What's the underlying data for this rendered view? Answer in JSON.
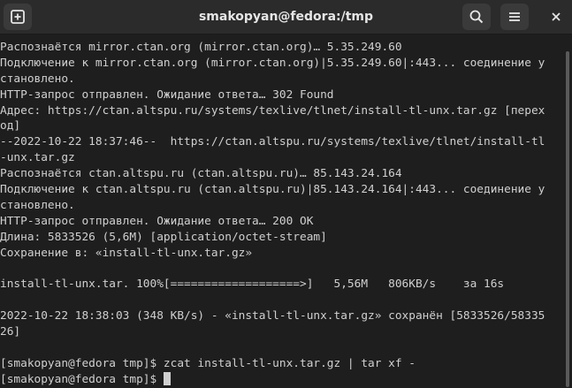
{
  "window": {
    "title": "smakopyan@fedora:/tmp"
  },
  "icons": {
    "new_tab": "new-tab-icon",
    "search": "search-icon",
    "menu": "hamburger-menu-icon",
    "close": "close-icon"
  },
  "terminal": {
    "lines": [
      "Распознаётся mirror.ctan.org (mirror.ctan.org)… 5.35.249.60",
      "Подключение к mirror.ctan.org (mirror.ctan.org)|5.35.249.60|:443... соединение у",
      "становлено.",
      "HTTP-запрос отправлен. Ожидание ответа… 302 Found",
      "Адрес: https://ctan.altspu.ru/systems/texlive/tlnet/install-tl-unx.tar.gz [перех",
      "од]",
      "--2022-10-22 18:37:46--  https://ctan.altspu.ru/systems/texlive/tlnet/install-tl",
      "-unx.tar.gz",
      "Распознаётся ctan.altspu.ru (ctan.altspu.ru)… 85.143.24.164",
      "Подключение к ctan.altspu.ru (ctan.altspu.ru)|85.143.24.164|:443... соединение у",
      "становлено.",
      "HTTP-запрос отправлен. Ожидание ответа… 200 OK",
      "Длина: 5833526 (5,6M) [application/octet-stream]",
      "Сохранение в: «install-tl-unx.tar.gz»",
      "",
      "install-tl-unx.tar. 100%[===================>]   5,56M   806KB/s    за 16s",
      "",
      "2022-10-22 18:38:03 (348 KB/s) - «install-tl-unx.tar.gz» сохранён [5833526/58335",
      "26]",
      "",
      "[smakopyan@fedora tmp]$ zcat install-tl-unx.tar.gz | tar xf -",
      "[smakopyan@fedora tmp]$ "
    ]
  },
  "colors": {
    "background": "#1e1e1e",
    "titlebar": "#2b2b2b",
    "text": "#d0d0d0"
  }
}
